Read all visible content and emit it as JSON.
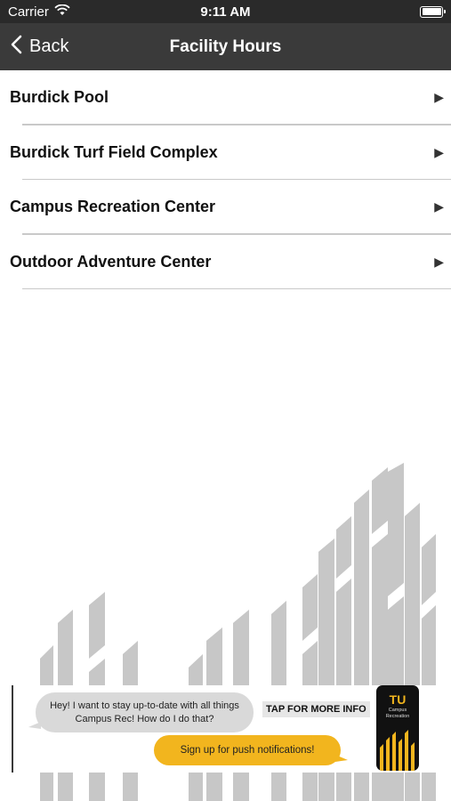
{
  "status_bar": {
    "carrier": "Carrier",
    "time": "9:11 AM"
  },
  "nav": {
    "back_label": "Back",
    "title": "Facility Hours"
  },
  "facilities": [
    {
      "label": "Burdick Pool"
    },
    {
      "label": "Burdick Turf Field Complex"
    },
    {
      "label": "Campus Recreation Center"
    },
    {
      "label": "Outdoor Adventure Center"
    }
  ],
  "row_arrow": "▶",
  "banner": {
    "question": "Hey! I want to stay up-to-date with all things Campus Rec! How do I do that?",
    "answer": "Sign up for push notifications!",
    "cta": "TAP FOR MORE INFO",
    "phone_logo": "TU",
    "phone_text": "Campus Recreation"
  },
  "colors": {
    "nav_background": "#3a3a3a",
    "status_background": "#2a2a2a",
    "accent_yellow": "#f2b51e",
    "bubble_gray": "#d9d9d9",
    "divider": "#c9c9c9",
    "art_gray": "#c7c7c7"
  }
}
